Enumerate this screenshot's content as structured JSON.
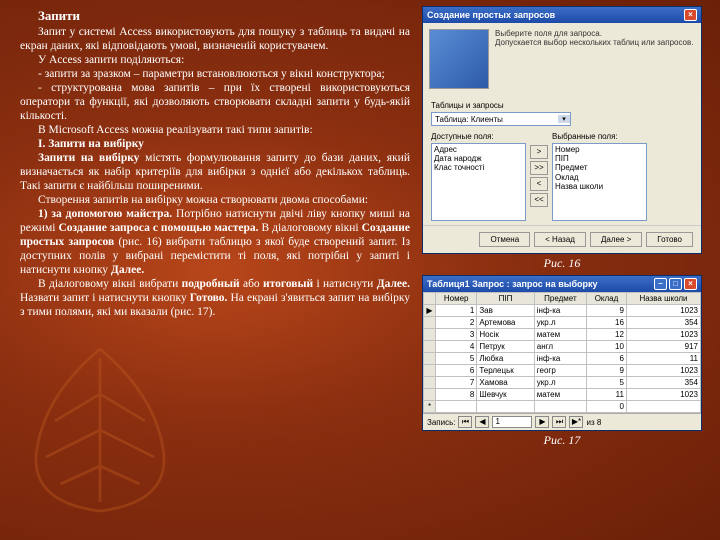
{
  "text": {
    "title": "Запити",
    "p1": "Запит у системі Access використовують для пошуку з таблиць та видачі на екран даних, які відповідають умові, визначеній користувачем.",
    "p2": "У Access запити поділяються:",
    "p3": "- запити за зразком – параметри встановлюються у вікні конструктора;",
    "p4": "- структурована мова запитів – при їх створені використовуються оператори та функції, які дозволяють створювати складні запити у будь-якій кількості.",
    "p5a": "В Microsoft Access можна реалізувати такі типи запитів:",
    "p5b": "I. Запити на вибірку",
    "p6": "Запити на вибірку",
    "p6c": " містять формулювання запиту до бази даних, який визначається як набір критеріїв для вибірки з однієї або декількох таблиць. Такі запити є найбільш поширеними.",
    "p7": "Створення запитів на вибірку можна створювати двома способами:",
    "p8a": "1) за допомогою майстра.",
    "p8b": " Потрібно натиснути двічі ліву кнопку миші на режимі ",
    "p8c": "Создание запроса с помощью мастера.",
    "p8d": " В діалоговому вікні ",
    "p8e": "Создание простых запросов",
    "p8f": " (рис. 16) вибрати таблицю з якої буде створений запит. Із доступних полів у вибрані перемістити ті поля, які потрібні у запиті і натиснути кнопку ",
    "p8g": "Далее.",
    "p9a": "В діалоговому вікні вибрати ",
    "p9b": "подробный",
    "p9c": " або ",
    "p9d": "итоговый",
    "p9e": " і натиснути ",
    "p9f": "Далее.",
    "p9g": " Назвати запит і натиснути кнопку ",
    "p9h": "Готово.",
    "p9i": " На екрані з'явиться запит на вибірку з тими полями, які ми вказали (рис. 17)."
  },
  "fig16": {
    "caption": "Рис. 16",
    "title": "Создание простых запросов",
    "hint1": "Выберите поля для запроса.",
    "hint2": "Допускается выбор нескольких таблиц или запросов.",
    "label_tables": "Таблицы и запросы",
    "combo_value": "Таблица: Клиенты",
    "label_avail": "Доступные поля:",
    "label_sel": "Выбранные поля:",
    "avail": [
      "Адрес",
      "Дата народж",
      "Клас точності"
    ],
    "sel": [
      "Номер",
      "ПІП",
      "Предмет",
      "Оклад",
      "Назва школи"
    ],
    "btn_cancel": "Отмена",
    "btn_back": "< Назад",
    "btn_next": "Далее >",
    "btn_finish": "Готово"
  },
  "fig17": {
    "caption": "Рис. 17",
    "title": "Таблиця1 Запрос : запрос на выборку",
    "headers": [
      "Номер",
      "ПІП",
      "Предмет",
      "Оклад",
      "Назва школи"
    ],
    "rows": [
      [
        "1",
        "Зав",
        "інф-ка",
        "9",
        "1023"
      ],
      [
        "2",
        "Артемова",
        "укр.л",
        "16",
        "354"
      ],
      [
        "3",
        "Носік",
        "матем",
        "12",
        "1023"
      ],
      [
        "4",
        "Петрук",
        "англ",
        "10",
        "917"
      ],
      [
        "5",
        "Любка",
        "інф-ка",
        "6",
        "11"
      ],
      [
        "6",
        "Терлецьк",
        "геогр",
        "9",
        "1023"
      ],
      [
        "7",
        "Хамова",
        "укр.л",
        "5",
        "354"
      ],
      [
        "8",
        "Шевчук",
        "матем",
        "11",
        "1023"
      ],
      [
        "",
        "",
        "",
        "0",
        ""
      ]
    ],
    "nav_label": "Запись:",
    "nav_value": "1",
    "nav_of": "из 8"
  }
}
